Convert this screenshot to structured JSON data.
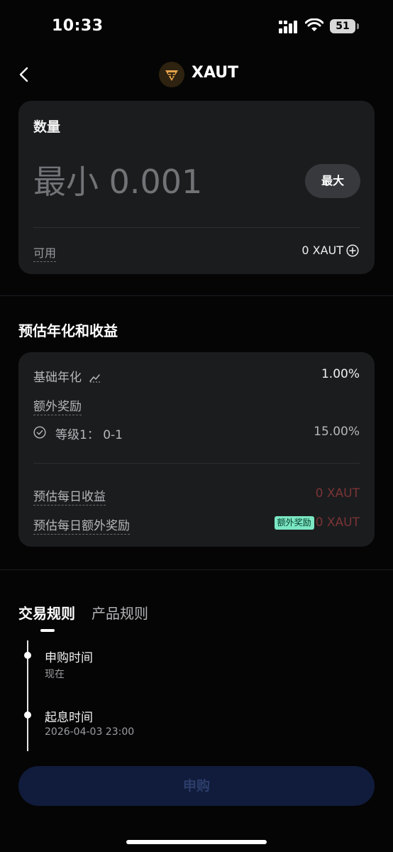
{
  "status_bar": {
    "time": "10:33",
    "battery": "51"
  },
  "header": {
    "title": "XAUT",
    "logo_icon": "tether-gold-icon"
  },
  "amount": {
    "label": "数量",
    "placeholder": "最小 0.001",
    "max_label": "最大",
    "available_label": "可用",
    "available_value": "0 XAUT"
  },
  "yield_section": {
    "title": "预估年化和收益",
    "base_apr_label": "基础年化",
    "base_apr_value": "1.00%",
    "extra_reward_label": "额外奖励",
    "tier_label": "等级1：  0-1",
    "tier_value": "15.00%",
    "daily_earnings_label": "预估每日收益",
    "daily_earnings_value": "0 XAUT",
    "daily_bonus_label": "预估每日额外奖励",
    "daily_bonus_badge": "额外奖励",
    "daily_bonus_value": "0 XAUT"
  },
  "tabs": [
    {
      "label": "交易规则",
      "active": true
    },
    {
      "label": "产品规则",
      "active": false
    }
  ],
  "timeline": [
    {
      "title": "申购时间",
      "subtitle": "现在"
    },
    {
      "title": "起息时间",
      "subtitle": "2026-04-03 23:00"
    }
  ],
  "subscribe_label": "申购",
  "colors": {
    "background": "#050505",
    "card": "#1b1c1e",
    "negative_value": "#7b3436",
    "badge": "#7ae6c2",
    "button_disabled": "#111c3c"
  }
}
